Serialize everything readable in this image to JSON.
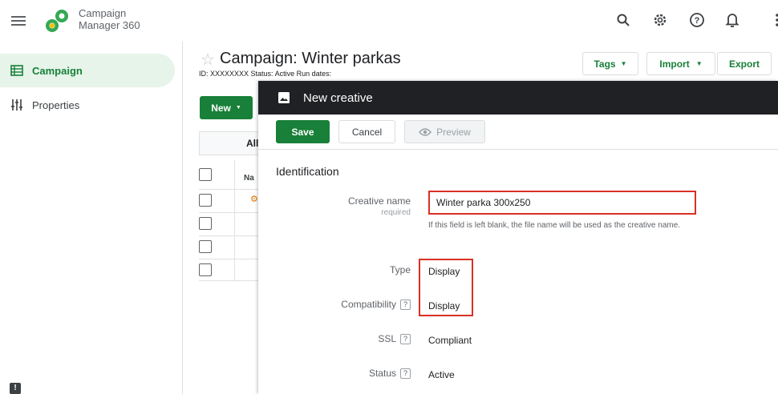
{
  "app": {
    "brand_line1": "Campaign",
    "brand_line2": "Manager 360"
  },
  "sidebar": {
    "items": [
      {
        "label": "Campaign",
        "active": true
      },
      {
        "label": "Properties",
        "active": false
      }
    ]
  },
  "campaign": {
    "title": "Campaign: Winter parkas",
    "id_text": "ID: XXXXXXXX",
    "status_text": "Status: Active",
    "run_dates_text": "Run dates:",
    "tags_label": "Tags",
    "import_label": "Import",
    "export_label": "Export",
    "new_label": "New",
    "filter_all_label": "All",
    "column_name_label": "Na"
  },
  "modal": {
    "title": "New creative",
    "save_label": "Save",
    "cancel_label": "Cancel",
    "preview_label": "Preview",
    "section_title": "Identification",
    "fields": {
      "creative_name_label": "Creative name",
      "creative_name_required": "required",
      "creative_name_value": "Winter parka 300x250",
      "creative_name_hint": "If this field is left blank, the file name will be used as the creative name.",
      "type_label": "Type",
      "type_value": "Display",
      "compatibility_label": "Compatibility",
      "compatibility_value": "Display",
      "ssl_label": "SSL",
      "ssl_value": "Compliant",
      "status_label": "Status",
      "status_value": "Active",
      "help_glyph": "?"
    }
  },
  "colors": {
    "accent": "#188038",
    "highlight": "#d93025",
    "dark_header": "#202124"
  }
}
